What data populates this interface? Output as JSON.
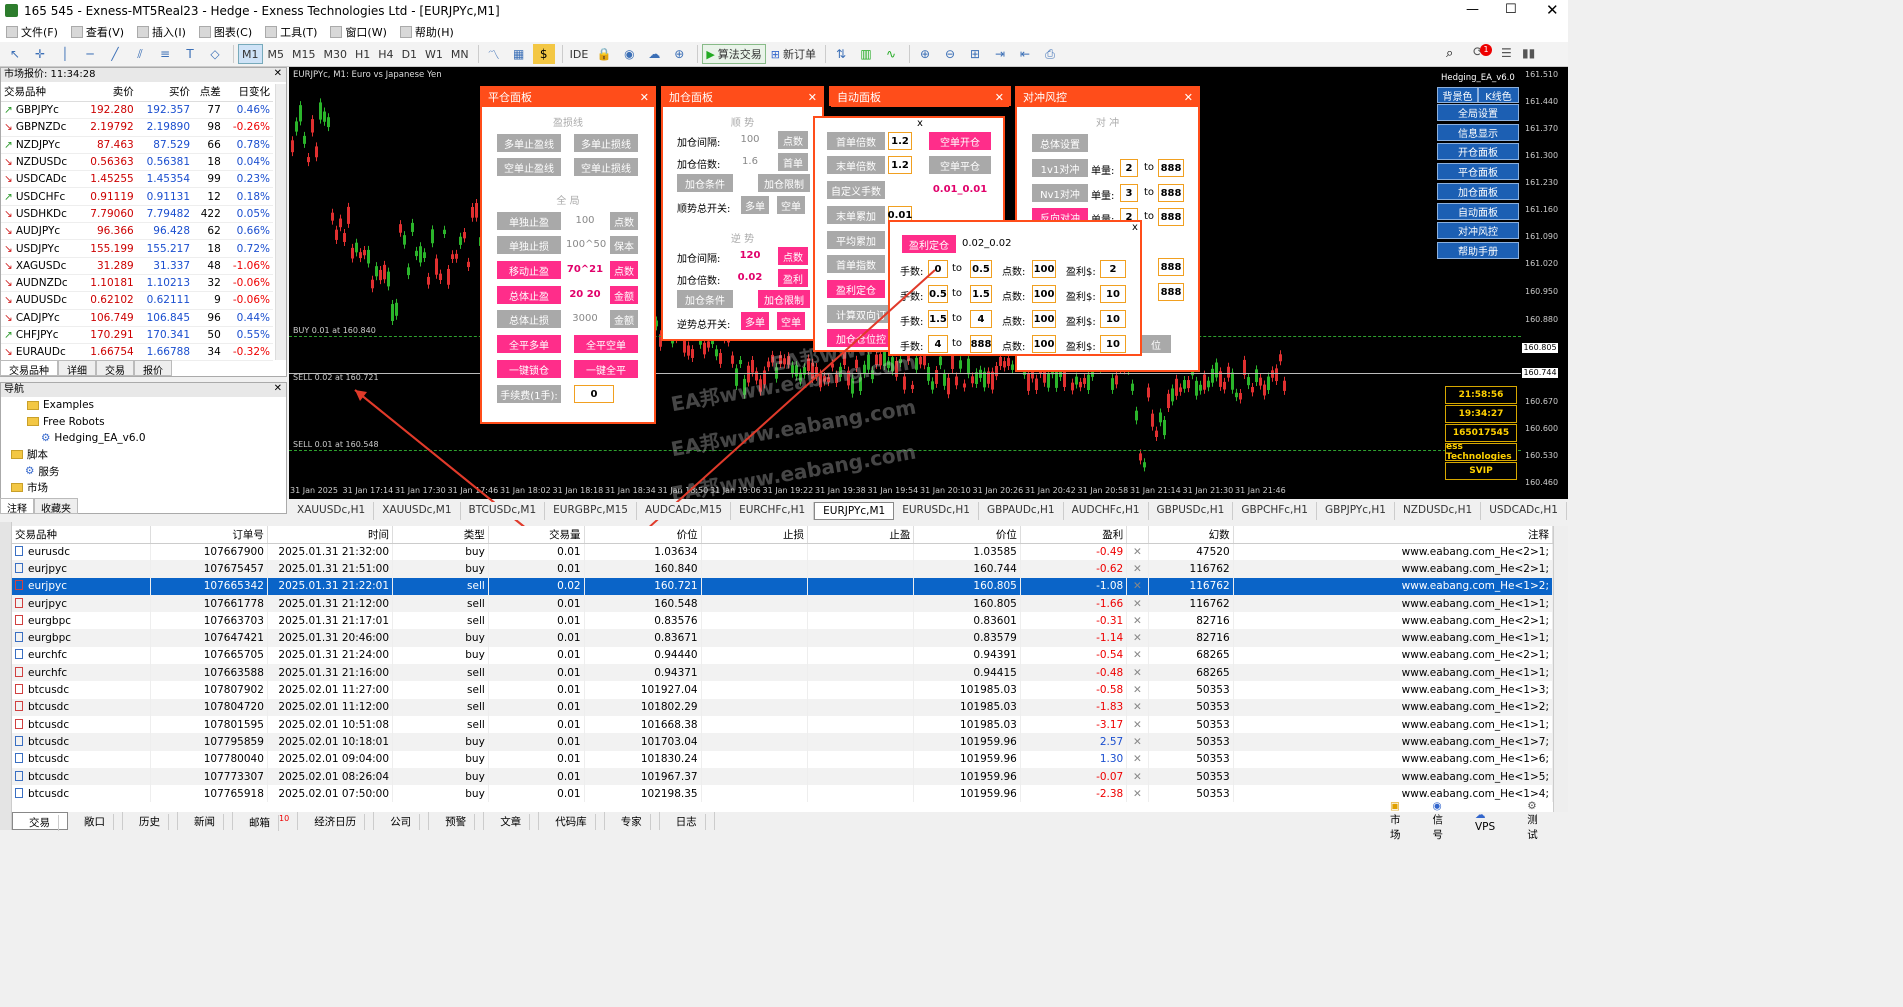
{
  "window": {
    "title": "165      545 - Exness-MT5Real23 - Hedge - Exness Technologies Ltd - [EURJPYc,M1]"
  },
  "menu": [
    "文件(F)",
    "查看(V)",
    "插入(I)",
    "图表(C)",
    "工具(T)",
    "窗口(W)",
    "帮助(H)"
  ],
  "toolbar": {
    "timeframes": [
      "M1",
      "M5",
      "M15",
      "M30",
      "H1",
      "H4",
      "D1",
      "W1",
      "MN"
    ],
    "ide": "IDE",
    "algo": "算法交易",
    "new_order": "新订单",
    "badge": "1"
  },
  "market_watch": {
    "header": "市场报价: 11:34:28",
    "cols": [
      "交易品种",
      "卖价",
      "买价",
      "点差",
      "日变化"
    ],
    "rows": [
      [
        "GBPJPYc",
        "192.280",
        "192.357",
        "77",
        "0.46%",
        "up"
      ],
      [
        "GBPNZDc",
        "2.19792",
        "2.19890",
        "98",
        "-0.26%",
        "dn"
      ],
      [
        "NZDJPYc",
        "87.463",
        "87.529",
        "66",
        "0.78%",
        "up"
      ],
      [
        "NZDUSDc",
        "0.56363",
        "0.56381",
        "18",
        "0.04%",
        "dn"
      ],
      [
        "USDCADc",
        "1.45255",
        "1.45354",
        "99",
        "0.23%",
        "dn"
      ],
      [
        "USDCHFc",
        "0.91119",
        "0.91131",
        "12",
        "0.18%",
        "up"
      ],
      [
        "USDHKDc",
        "7.79060",
        "7.79482",
        "422",
        "0.05%",
        "dn"
      ],
      [
        "AUDJPYc",
        "96.366",
        "96.428",
        "62",
        "0.66%",
        "dn"
      ],
      [
        "USDJPYc",
        "155.199",
        "155.217",
        "18",
        "0.72%",
        "dn"
      ],
      [
        "XAGUSDc",
        "31.289",
        "31.337",
        "48",
        "-1.06%",
        "dn"
      ],
      [
        "AUDNZDc",
        "1.10181",
        "1.10213",
        "32",
        "-0.06%",
        "dn"
      ],
      [
        "AUDUSDc",
        "0.62102",
        "0.62111",
        "9",
        "-0.06%",
        "dn"
      ],
      [
        "CADJPYc",
        "106.749",
        "106.845",
        "96",
        "0.44%",
        "dn"
      ],
      [
        "CHFJPYc",
        "170.291",
        "170.341",
        "50",
        "0.55%",
        "up"
      ],
      [
        "EURAUDc",
        "1.66754",
        "1.66788",
        "34",
        "-0.32%",
        "dn"
      ]
    ],
    "tabs": [
      "交易品种",
      "详细",
      "交易",
      "报价"
    ]
  },
  "navigator": {
    "header": "导航",
    "items": [
      "Examples",
      "Free Robots",
      "Hedging_EA_v6.0",
      "脚本",
      "服务",
      "市场"
    ],
    "tabs": [
      "注释",
      "收藏夹"
    ]
  },
  "chart": {
    "symbol": "EURJPYc, M1:  Euro vs Japanese Yen",
    "ea_name": "Hedging_EA_v6.0",
    "y_ticks": [
      "161.510",
      "161.440",
      "161.370",
      "161.300",
      "161.230",
      "161.160",
      "161.090",
      "161.020",
      "160.950",
      "160.880",
      "160.805",
      "160.744",
      "160.670",
      "160.600",
      "160.530",
      "160.460"
    ],
    "x_ticks": [
      "31 Jan 2025",
      "31 Jan 17:14",
      "31 Jan 17:30",
      "31 Jan 17:46",
      "31 Jan 18:02",
      "31 Jan 18:18",
      "31 Jan 18:34",
      "31 Jan 18:50",
      "31 Jan 19:06",
      "31 Jan 19:22",
      "31 Jan 19:38",
      "31 Jan 19:54",
      "31 Jan 20:10",
      "31 Jan 20:26",
      "31 Jan 20:42",
      "31 Jan 20:58",
      "31 Jan 21:14",
      "31 Jan 21:30",
      "31 Jan 21:46"
    ],
    "levels": [
      "BUY 0.01 at 160.840",
      "SELL 0.02 at 160.721",
      "SELL 0.01 at 160.548"
    ],
    "right_buttons": [
      "背景色",
      "K线色",
      "全局设置",
      "信息显示",
      "开仓面板",
      "平仓面板",
      "加仓面板",
      "自动面板",
      "对冲风控",
      "帮助手册"
    ],
    "info_boxes": [
      "21:58:56",
      "19:34:27",
      "165017545",
      "ess Technologies",
      "SVIP"
    ],
    "watermark": "EA邦www.eabang.com"
  },
  "panel_close": {
    "title": "平仓面板",
    "sect1": "盈损线",
    "b1": "多单止盈线",
    "b2": "多单止损线",
    "b3": "空单止盈线",
    "b4": "空单止损线",
    "sect2": "全  局",
    "r1": [
      "单独止盈",
      "100",
      "点数"
    ],
    "r2": [
      "单独止损",
      "100^50",
      "保本"
    ],
    "r3": [
      "移动止盈",
      "70^21",
      "点数"
    ],
    "r4": [
      "总体止盈",
      "20 20",
      "金额"
    ],
    "r5": [
      "总体止损",
      "3000",
      "金额"
    ],
    "b5": "全平多单",
    "b6": "全平空单",
    "b7": "一键锁仓",
    "b8": "一键全平",
    "fee_label": "手续费(1手):",
    "fee_val": "0"
  },
  "panel_add": {
    "title": "加仓面板",
    "sect1": "顺  势",
    "l1": "加仓间隔:",
    "v1": "100",
    "u1": "点数",
    "l2": "加仓倍数:",
    "v2": "1.6",
    "u2": "首单",
    "b1": "加仓条件",
    "b2": "加仓限制",
    "l3": "顺势总开关:",
    "b3": "多单",
    "b4": "空单",
    "sect2": "逆  势",
    "l4": "加仓间隔:",
    "v4": "120",
    "u4": "点数",
    "l5": "加仓倍数:",
    "v5": "0.02",
    "u5": "盈利",
    "b5": "加仓条件",
    "b6": "加仓限制",
    "l6": "逆势总开关:",
    "b7": "多单",
    "b8": "空单"
  },
  "panel_auto": {
    "title": "自动面板",
    "b1": "首单倍数",
    "v1": "1.2",
    "b2": "末单倍数",
    "v2": "1.2",
    "b3": "自定义手数",
    "b4": "末单累加",
    "v4": "0.01",
    "b5": "平均累加",
    "b6": "首单指数",
    "b7": "盈利定仓",
    "b8": "计算双向订",
    "b9": "加仓仓位控",
    "p1": "空单开仓",
    "p2": "空单平仓",
    "p3": "0.01_0.01"
  },
  "panel_hedge": {
    "title": "对冲风控",
    "sect": "对  冲",
    "b1": "总体设置",
    "b2": "1v1对冲",
    "b3": "Nv1对冲",
    "b4": "反向对冲",
    "lbl": "单量:",
    "to": "to",
    "r1": [
      "2",
      "888"
    ],
    "r2": [
      "3",
      "888"
    ],
    "r3": [
      "2",
      "888"
    ],
    "r4": "888",
    "r5": "888",
    "partial": "位"
  },
  "popup": {
    "btn": "盈利定仓",
    "val": "0.02_0.02",
    "rows": [
      [
        "0",
        "0.5",
        "100",
        "2"
      ],
      [
        "0.5",
        "1.5",
        "100",
        "10"
      ],
      [
        "1.5",
        "4",
        "100",
        "10"
      ],
      [
        "4",
        "888",
        "100",
        "10"
      ]
    ],
    "l_lots": "手数:",
    "l_to": "to",
    "l_pts": "点数:",
    "l_pl": "盈利$:"
  },
  "chart_tabs": [
    "XAUUSDc,H1",
    "XAUUSDc,M1",
    "BTCUSDc,M1",
    "EURGBPc,M15",
    "AUDCADc,M15",
    "EURCHFc,H1",
    "EURJPYc,M1",
    "EURUSDc,H1",
    "GBPAUDc,H1",
    "AUDCHFc,H1",
    "GBPUSDc,H1",
    "GBPCHFc,H1",
    "GBPJPYc,H1",
    "NZDUSDc,H1",
    "USDCADc,H1"
  ],
  "trade_table": {
    "cols": [
      "交易品种",
      "订单号",
      "时间",
      "类型",
      "交易量",
      "价位",
      "止损",
      "止盈",
      "价位",
      "盈利",
      "",
      "幻数",
      "注释"
    ],
    "rows": [
      [
        "eurusdc",
        "107667900",
        "2025.01.31 21:32:00",
        "buy",
        "0.01",
        "1.03634",
        "",
        "",
        "1.03585",
        "-0.49",
        "47520",
        "www.eabang.com_He<2>1;"
      ],
      [
        "eurjpyc",
        "107675457",
        "2025.01.31 21:51:00",
        "buy",
        "0.01",
        "160.840",
        "",
        "",
        "160.744",
        "-0.62",
        "116762",
        "www.eabang.com_He<2>1;"
      ],
      [
        "eurjpyc",
        "107665342",
        "2025.01.31 21:22:01",
        "sell",
        "0.02",
        "160.721",
        "",
        "",
        "160.805",
        "-1.08",
        "116762",
        "www.eabang.com_He<1>2;"
      ],
      [
        "eurjpyc",
        "107661778",
        "2025.01.31 21:12:00",
        "sell",
        "0.01",
        "160.548",
        "",
        "",
        "160.805",
        "-1.66",
        "116762",
        "www.eabang.com_He<1>1;"
      ],
      [
        "eurgbpc",
        "107663703",
        "2025.01.31 21:17:01",
        "sell",
        "0.01",
        "0.83576",
        "",
        "",
        "0.83601",
        "-0.31",
        "82716",
        "www.eabang.com_He<2>1;"
      ],
      [
        "eurgbpc",
        "107647421",
        "2025.01.31 20:46:00",
        "buy",
        "0.01",
        "0.83671",
        "",
        "",
        "0.83579",
        "-1.14",
        "82716",
        "www.eabang.com_He<1>1;"
      ],
      [
        "eurchfc",
        "107665705",
        "2025.01.31 21:24:00",
        "buy",
        "0.01",
        "0.94440",
        "",
        "",
        "0.94391",
        "-0.54",
        "68265",
        "www.eabang.com_He<2>1;"
      ],
      [
        "eurchfc",
        "107663588",
        "2025.01.31 21:16:00",
        "sell",
        "0.01",
        "0.94371",
        "",
        "",
        "0.94415",
        "-0.48",
        "68265",
        "www.eabang.com_He<1>1;"
      ],
      [
        "btcusdc",
        "107807902",
        "2025.02.01 11:27:00",
        "sell",
        "0.01",
        "101927.04",
        "",
        "",
        "101985.03",
        "-0.58",
        "50353",
        "www.eabang.com_He<1>3;"
      ],
      [
        "btcusdc",
        "107804720",
        "2025.02.01 11:12:00",
        "sell",
        "0.01",
        "101802.29",
        "",
        "",
        "101985.03",
        "-1.83",
        "50353",
        "www.eabang.com_He<1>2;"
      ],
      [
        "btcusdc",
        "107801595",
        "2025.02.01 10:51:08",
        "sell",
        "0.01",
        "101668.38",
        "",
        "",
        "101985.03",
        "-3.17",
        "50353",
        "www.eabang.com_He<1>1;"
      ],
      [
        "btcusdc",
        "107795859",
        "2025.02.01 10:18:01",
        "buy",
        "0.01",
        "101703.04",
        "",
        "",
        "101959.96",
        "2.57",
        "50353",
        "www.eabang.com_He<1>7;"
      ],
      [
        "btcusdc",
        "107780040",
        "2025.02.01 09:04:00",
        "buy",
        "0.01",
        "101830.24",
        "",
        "",
        "101959.96",
        "1.30",
        "50353",
        "www.eabang.com_He<1>6;"
      ],
      [
        "btcusdc",
        "107773307",
        "2025.02.01 08:26:04",
        "buy",
        "0.01",
        "101967.37",
        "",
        "",
        "101959.96",
        "-0.07",
        "50353",
        "www.eabang.com_He<1>5;"
      ],
      [
        "btcusdc",
        "107765918",
        "2025.02.01 07:50:00",
        "buy",
        "0.01",
        "102198.35",
        "",
        "",
        "101959.96",
        "-2.38",
        "50353",
        "www.eabang.com_He<1>4;"
      ]
    ]
  },
  "bottom_tabs": [
    "交易",
    "敞口",
    "历史",
    "新闻",
    "邮箱",
    "经济日历",
    "公司",
    "预警",
    "文章",
    "代码库",
    "专家",
    "日志"
  ],
  "mail_count": "10",
  "status": [
    "市场",
    "信号",
    "VPS",
    "测试"
  ],
  "colors": {
    "accent": "#ff4d1a",
    "pink": "#ff2d8a",
    "select": "#0a64c8"
  }
}
